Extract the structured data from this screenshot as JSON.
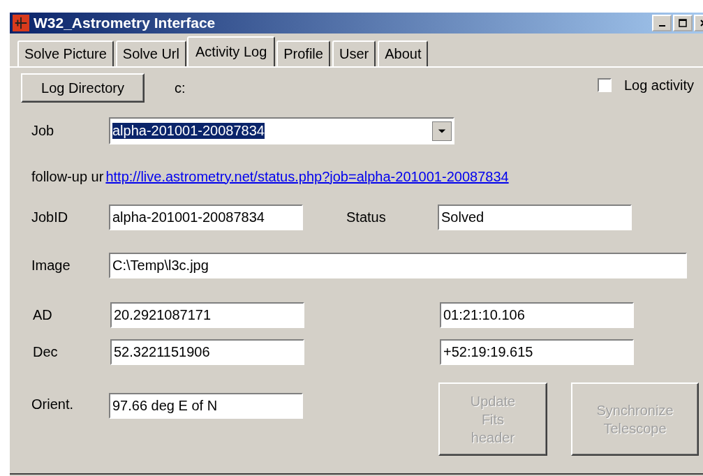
{
  "window": {
    "title": "W32_Astrometry Interface"
  },
  "tabs": [
    {
      "label": "Solve Picture",
      "selected": false
    },
    {
      "label": "Solve Url",
      "selected": false
    },
    {
      "label": "Activity Log",
      "selected": true
    },
    {
      "label": "Profile",
      "selected": false
    },
    {
      "label": "User",
      "selected": false
    },
    {
      "label": "About",
      "selected": false
    }
  ],
  "log_directory": {
    "button": "Log Directory",
    "path": "c:"
  },
  "log_activity": {
    "label": "Log activity",
    "checked": false
  },
  "job": {
    "label": "Job",
    "value": "alpha-201001-20087834",
    "text_selected": true
  },
  "follow_up": {
    "label": "follow-up ur",
    "link": "http://live.astrometry.net/status.php?job=alpha-201001-20087834"
  },
  "job_id": {
    "label": "JobID",
    "value": "alpha-201001-20087834"
  },
  "status": {
    "label": "Status",
    "value": "Solved"
  },
  "image": {
    "label": "Image",
    "value": "C:\\Temp\\l3c.jpg"
  },
  "ad": {
    "label": "AD",
    "value": "20.2921087171",
    "sexagesimal": "01:21:10.106"
  },
  "dec": {
    "label": "Dec",
    "value": "52.3221151906",
    "sexagesimal": "+52:19:19.615"
  },
  "orient": {
    "label": "Orient.",
    "value": "97.66 deg E of N"
  },
  "buttons": [
    {
      "label": "Update\nFits\nheader",
      "disabled": true
    },
    {
      "label": "Synchronize\nTelescope",
      "disabled": true
    }
  ]
}
